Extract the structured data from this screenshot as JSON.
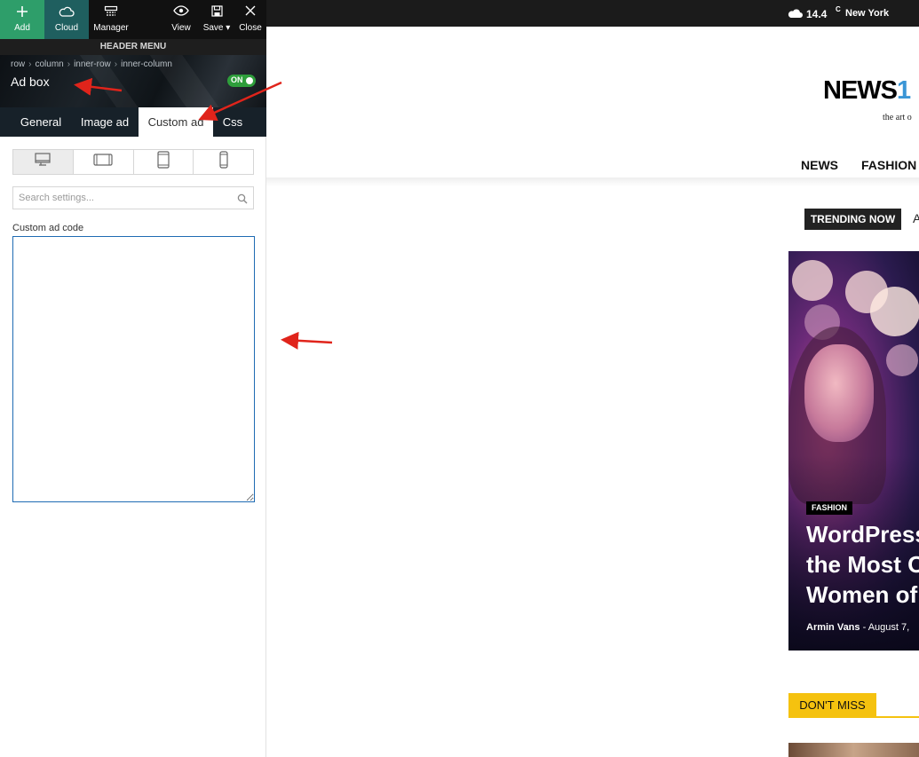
{
  "toolbar": {
    "add_label": "Add",
    "cloud_label": "Cloud",
    "manager_label": "Manager",
    "view_label": "View",
    "save_label": "Save",
    "close_label": "Close"
  },
  "panel": {
    "section_label": "HEADER MENU",
    "breadcrumb": [
      "row",
      "column",
      "inner-row",
      "inner-column"
    ],
    "element_title": "Ad box",
    "toggle_label": "ON",
    "tabs": [
      "General",
      "Image ad",
      "Custom ad",
      "Css"
    ],
    "active_tab": "Custom ad",
    "devices": [
      "desktop-icon",
      "tablet-landscape-icon",
      "tablet-portrait-icon",
      "phone-icon"
    ],
    "search_placeholder": "Search settings...",
    "custom_code_label": "Custom ad code",
    "custom_code_value": ""
  },
  "site": {
    "weather_temp": "14.4",
    "weather_unit": "C",
    "weather_city": "New York",
    "logo_text": "NEWS",
    "logo_accent": "1",
    "tagline": "the art o",
    "nav": [
      "NEWS",
      "FASHION"
    ],
    "trending_label": "TRENDING NOW",
    "trending_next": "A",
    "hero_category": "FASHION",
    "hero_title_lines": [
      "WordPress",
      "the Most O",
      "Women of"
    ],
    "hero_author": "Armin Vans",
    "hero_date": "August 7,",
    "dont_miss_label": "DON'T MISS"
  },
  "colors": {
    "add_green": "#2e9e6a",
    "cloud_teal": "#1f5f5f",
    "toggle_green": "#2e9e3b",
    "textarea_border": "#1f6bb3",
    "logo_blue": "#3b96d6",
    "dont_miss_yellow": "#f5c20f",
    "arrow_red": "#e0241b"
  }
}
